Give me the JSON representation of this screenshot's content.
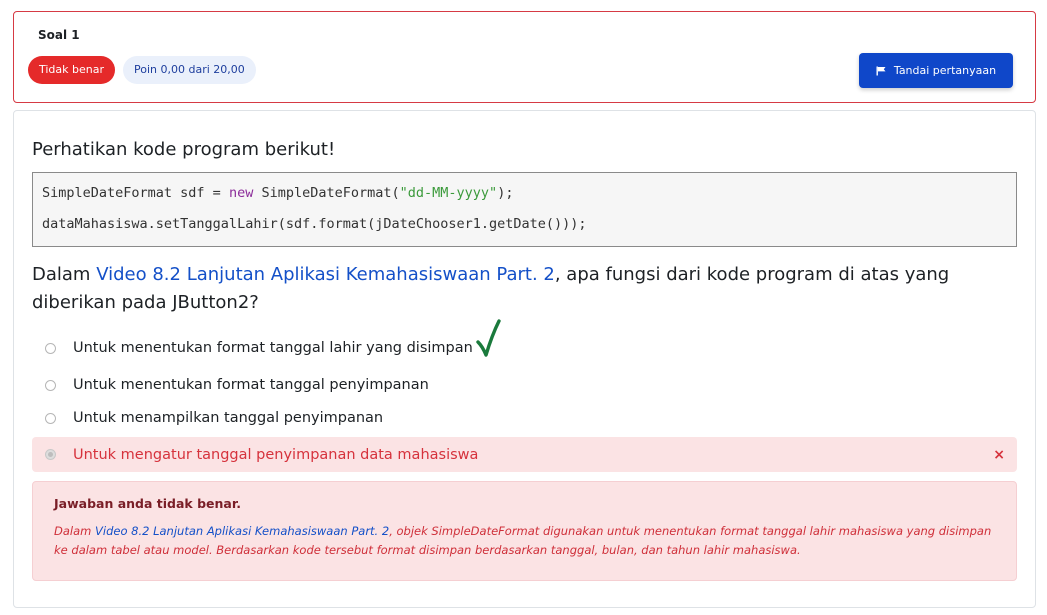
{
  "info": {
    "title": "Soal 1",
    "state": "Tidak benar",
    "grade": "Poin 0,00 dari 20,00",
    "flag_label": "Tandai pertanyaan"
  },
  "question": {
    "intro": "Perhatikan kode program berikut!",
    "code": {
      "line1": {
        "p1": "SimpleDateFormat sdf = ",
        "kw": "new",
        "p2": " SimpleDateFormat(",
        "str": "\"dd-MM-yyyy\"",
        "p3": ");"
      },
      "line2": "dataMahasiswa.setTanggalLahir(sdf.format(jDateChooser1.getDate()));"
    },
    "text_before": "Dalam ",
    "text_link": "Video 8.2 Lanjutan Aplikasi Kemahasiswaan Part. 2",
    "text_after": ", apa fungsi dari kode program di atas yang diberikan pada JButton2?"
  },
  "answers": [
    {
      "label": "Untuk menentukan format tanggal lahir yang disimpan"
    },
    {
      "label": "Untuk menentukan format tanggal penyimpanan"
    },
    {
      "label": "Untuk menampilkan tanggal penyimpanan"
    },
    {
      "label": "Untuk mengatur tanggal penyimpanan data mahasiswa",
      "selected": true,
      "incorrect_mark": "×"
    }
  ],
  "feedback": {
    "title": "Jawaban anda tidak benar.",
    "before": "Dalam ",
    "link": "Video 8.2 Lanjutan Aplikasi Kemahasiswaan Part. 2",
    "after": ", objek SimpleDateFormat digunakan untuk menentukan format tanggal lahir mahasiswa yang disimpan ke dalam tabel atau model. Berdasarkan kode tersebut format disimpan berdasarkan tanggal, bulan, dan tahun lahir mahasiswa."
  },
  "colors": {
    "danger": "#e52a2a",
    "primary": "#0f47c9",
    "link": "#1450c8",
    "checkmark": "#1a7a3c"
  },
  "icons": {
    "flag": "flag-icon",
    "check": "checkmark-icon",
    "close": "close-icon"
  }
}
